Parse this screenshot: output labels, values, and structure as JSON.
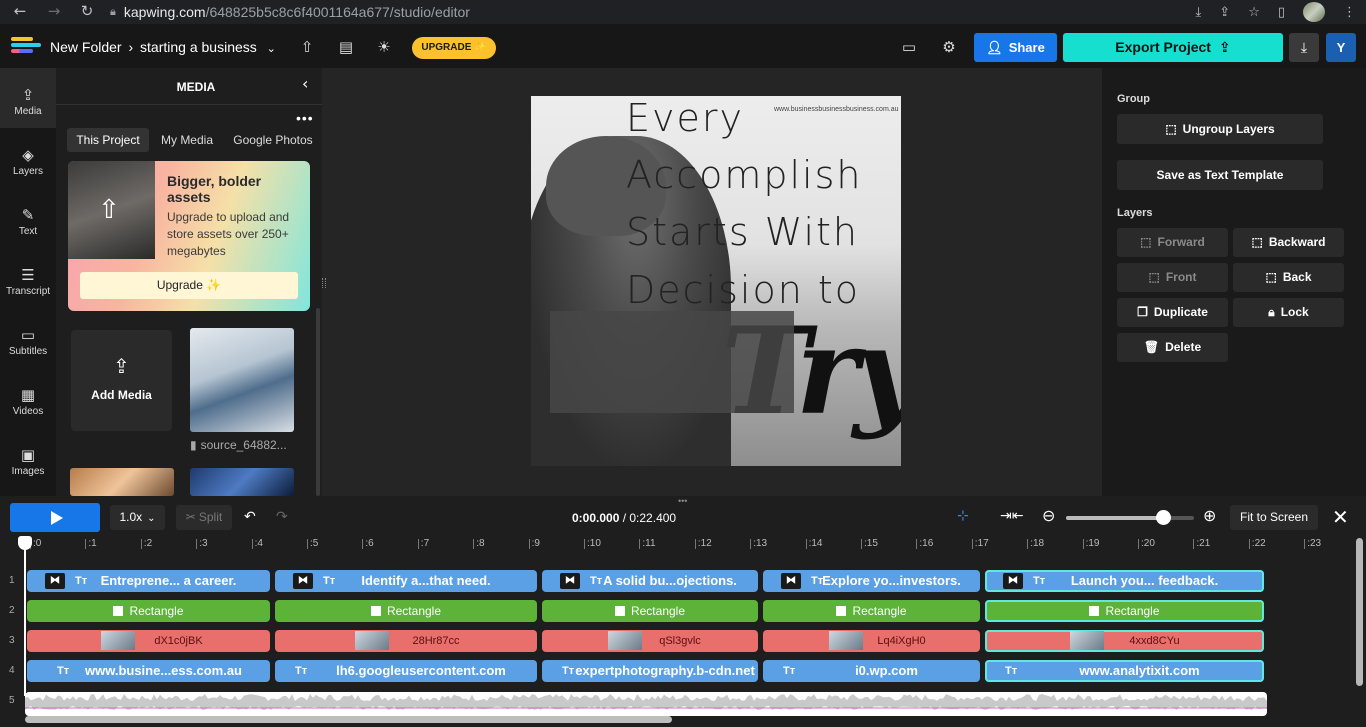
{
  "browser": {
    "url_host": "kapwing.com",
    "url_path": "/648825b5c8c6f4001164a677/studio/editor"
  },
  "header": {
    "folder": "New Folder",
    "separator": "›",
    "project": "starting a business",
    "upgrade": "UPGRADE ✨",
    "share": "Share",
    "export": "Export Project",
    "user_initial": "Y"
  },
  "leftnav": [
    {
      "label": "Media",
      "icon": "upload-cloud-icon"
    },
    {
      "label": "Layers",
      "icon": "layers-icon"
    },
    {
      "label": "Text",
      "icon": "text-edit-icon"
    },
    {
      "label": "Transcript",
      "icon": "transcript-icon"
    },
    {
      "label": "Subtitles",
      "icon": "subtitles-icon"
    },
    {
      "label": "Videos",
      "icon": "film-icon"
    },
    {
      "label": "Images",
      "icon": "image-icon"
    }
  ],
  "media": {
    "title": "MEDIA",
    "tabs": [
      "This Project",
      "My Media",
      "Google Photos"
    ],
    "promo": {
      "title": "Bigger, bolder assets",
      "body": "Upgrade to upload and store assets over 250+ megabytes",
      "button": "Upgrade ✨"
    },
    "add_media": "Add Media",
    "thumb_caption": "source_64882..."
  },
  "canvas": {
    "quote_lines": [
      "Every",
      "Accomplish",
      "Starts With",
      "Decision to"
    ],
    "script_word": "Try",
    "watermark": "www.businessbusinessbusiness.com.au"
  },
  "rightpanel": {
    "group_label": "Group",
    "ungroup": "Ungroup Layers",
    "save_template": "Save as Text Template",
    "layers_label": "Layers",
    "forward": "Forward",
    "backward": "Backward",
    "front": "Front",
    "back": "Back",
    "duplicate": "Duplicate",
    "lock": "Lock",
    "delete": "Delete"
  },
  "timeline": {
    "speed": "1.0x",
    "split": "Split",
    "time_current": "0:00.000",
    "time_total": " / 0:22.400",
    "fit": "Fit to Screen",
    "zoom_level": 0.76,
    "ticks": [
      ":0",
      ":1",
      ":2",
      ":3",
      ":4",
      ":5",
      ":6",
      ":7",
      ":8",
      ":9",
      ":10",
      ":11",
      ":12",
      ":13",
      ":14",
      ":15",
      ":16",
      ":17",
      ":18",
      ":19",
      ":20",
      ":21",
      ":22",
      ":23"
    ],
    "track_numbers": [
      "1",
      "2",
      "3",
      "4",
      "5"
    ],
    "track1": [
      "Entreprene... a career.",
      "Identify a...that need.",
      "A solid bu...ojections.",
      "Explore yo...investors.",
      "Launch you... feedback."
    ],
    "track2": [
      "Rectangle",
      "Rectangle",
      "Rectangle",
      "Rectangle",
      "Rectangle"
    ],
    "track3": [
      "dX1c0jBK",
      "28Hr87cc",
      "qSl3gvlc",
      "Lq4iXgH0",
      "4xxd8CYu"
    ],
    "track4": [
      "www.busine...ess.com.au",
      "lh6.googleusercontent.com",
      "expertphotography.b-cdn.net",
      "i0.wp.com",
      "www.analytixit.com"
    ],
    "text_icon": "Tт"
  }
}
